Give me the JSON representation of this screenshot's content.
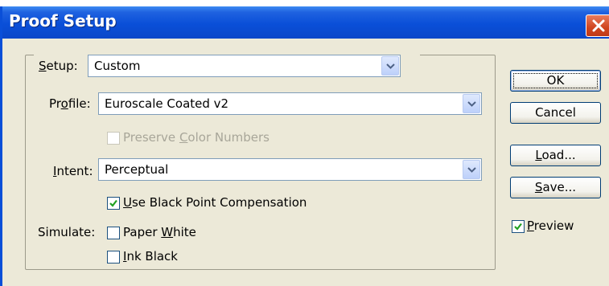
{
  "window": {
    "title": "Proof Setup",
    "close_icon": "close-icon"
  },
  "setup": {
    "label": "Setup:",
    "value": "Custom"
  },
  "profile": {
    "label": "Profile:",
    "value": "Euroscale Coated v2"
  },
  "preserve_color_numbers": {
    "label": "Preserve Color Numbers",
    "checked": false,
    "enabled": false
  },
  "intent": {
    "label": "Intent:",
    "value": "Perceptual"
  },
  "black_point": {
    "label": "Use Black Point Compensation",
    "checked": true
  },
  "simulate": {
    "label": "Simulate:",
    "paper_white_label": "Paper White",
    "paper_white_checked": false,
    "ink_black_label": "Ink Black",
    "ink_black_checked": false
  },
  "buttons": {
    "ok": "OK",
    "cancel": "Cancel",
    "load": "Load...",
    "save": "Save..."
  },
  "preview": {
    "label": "Preview",
    "checked": true
  },
  "colors": {
    "title_bar": "#0a4fd8",
    "dialog_bg": "#ece9d8",
    "checkmark": "#21a121"
  }
}
